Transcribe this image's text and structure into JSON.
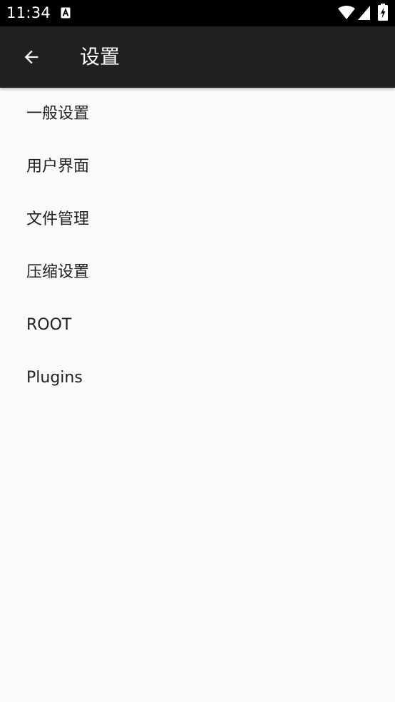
{
  "status_bar": {
    "time": "11:34",
    "notification_icon": "text-a-icon",
    "icons": [
      "wifi-icon",
      "cell-signal-icon",
      "battery-icon"
    ]
  },
  "toolbar": {
    "back_icon": "arrow-back-icon",
    "title": "设置"
  },
  "settings": {
    "items": [
      {
        "label": "一般设置"
      },
      {
        "label": "用户界面"
      },
      {
        "label": "文件管理"
      },
      {
        "label": "压缩设置"
      },
      {
        "label": "ROOT"
      },
      {
        "label": "Plugins"
      }
    ]
  },
  "colors": {
    "status_bar_bg": "#000000",
    "toolbar_bg": "#212121",
    "toolbar_text": "#ffffff",
    "page_bg": "#fafafa",
    "item_text": "#212121"
  }
}
